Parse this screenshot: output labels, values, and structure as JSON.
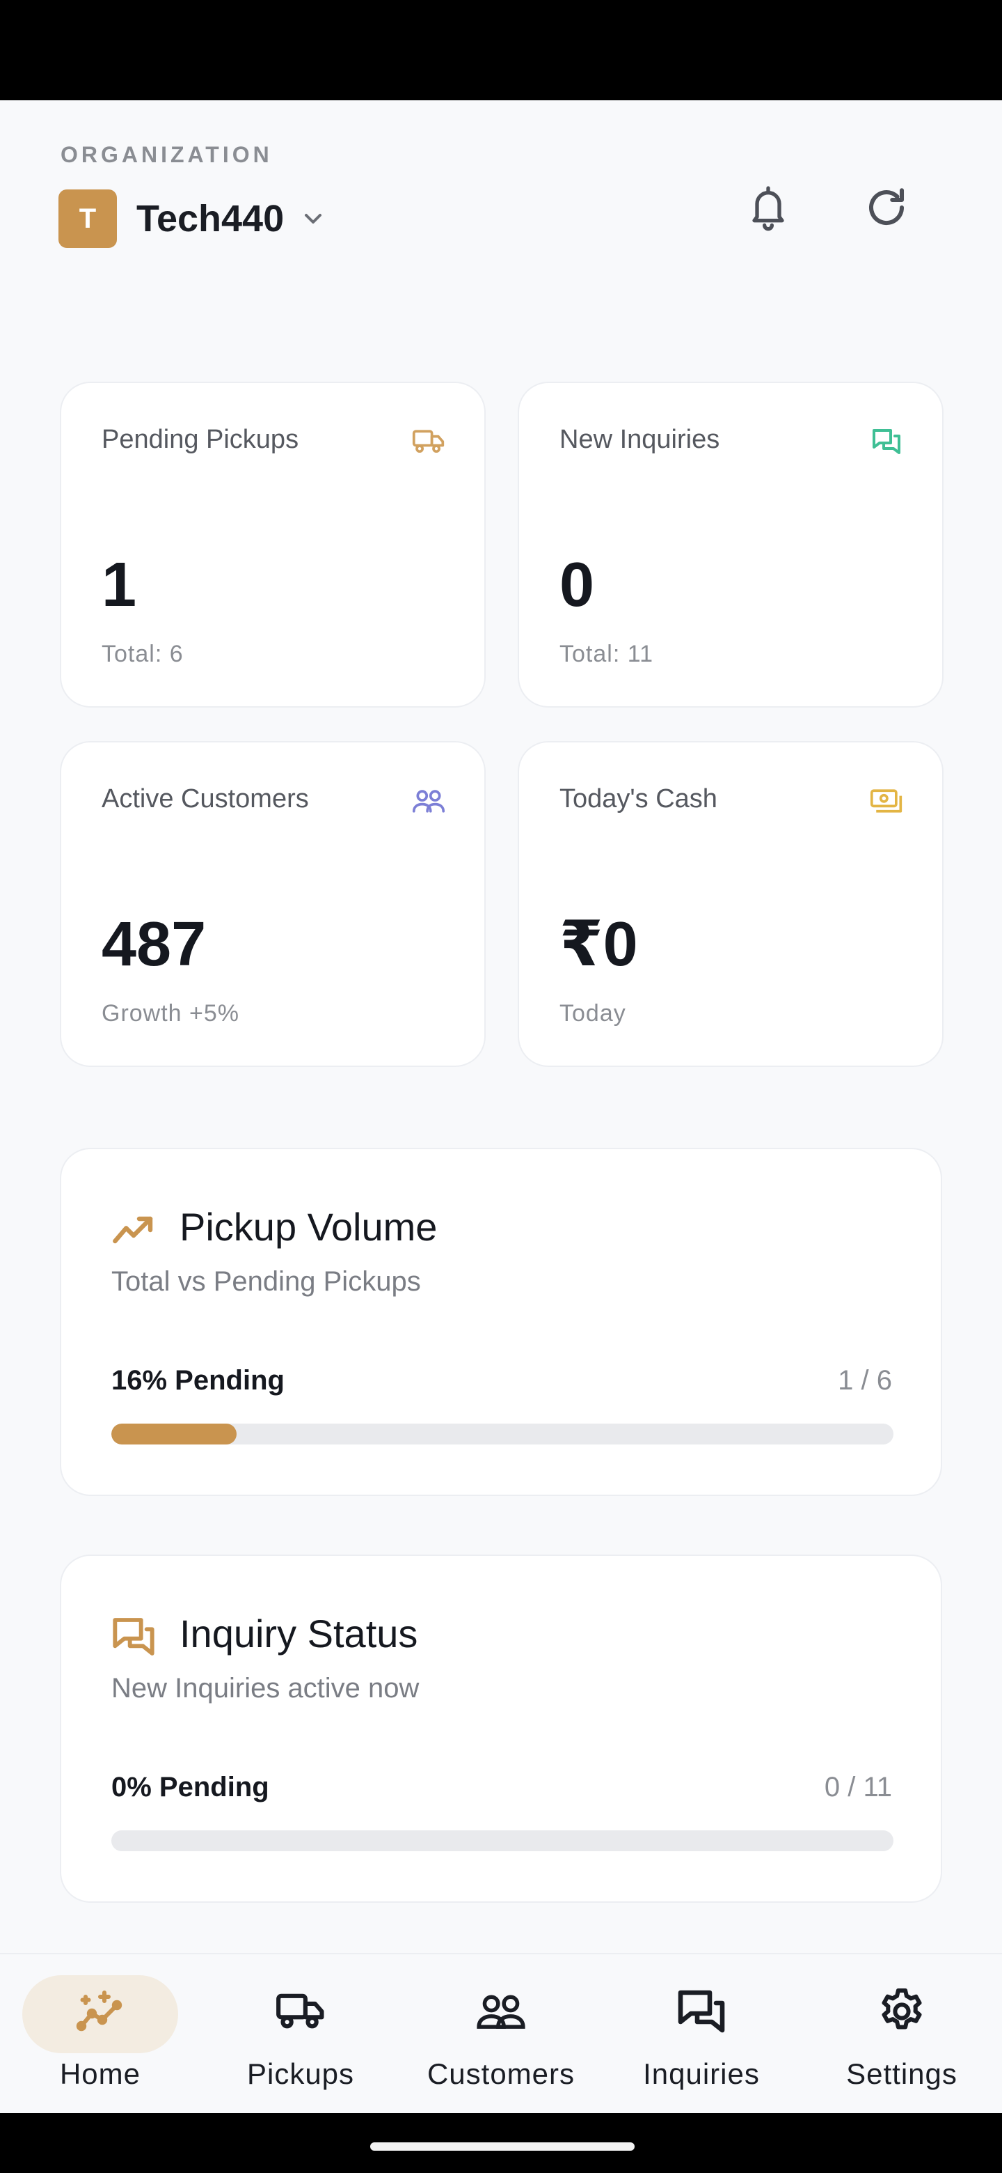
{
  "header": {
    "org_label": "ORGANIZATION",
    "org_initial": "T",
    "org_name": "Tech440"
  },
  "stats": [
    {
      "label": "Pending Pickups",
      "value": "1",
      "sub": "Total: 6",
      "icon": "truck-icon",
      "color": "#d1a15f"
    },
    {
      "label": "New Inquiries",
      "value": "0",
      "sub": "Total: 11",
      "icon": "chat-icon",
      "color": "#3fbf95"
    },
    {
      "label": "Active Customers",
      "value": "487",
      "sub": "Growth +5%",
      "icon": "users-icon",
      "color": "#7c7fd6"
    },
    {
      "label": "Today's Cash",
      "value": "₹0",
      "sub": "Today",
      "icon": "cash-icon",
      "color": "#e3b544"
    }
  ],
  "pickup_volume": {
    "title": "Pickup Volume",
    "subtitle": "Total vs Pending Pickups",
    "percent_label": "16% Pending",
    "count": "1 / 6",
    "progress_percent": 16
  },
  "inquiry_status": {
    "title": "Inquiry Status",
    "subtitle": "New Inquiries active now",
    "percent_label": "0% Pending",
    "count": "0 / 11",
    "progress_percent": 0
  },
  "nav": {
    "active": "home",
    "items": [
      {
        "label": "Home"
      },
      {
        "label": "Pickups"
      },
      {
        "label": "Customers"
      },
      {
        "label": "Inquiries"
      },
      {
        "label": "Settings"
      }
    ]
  },
  "colors": {
    "accent": "#c9944f",
    "accent_soft": "#f3ece1",
    "background": "#f8f9fb"
  }
}
